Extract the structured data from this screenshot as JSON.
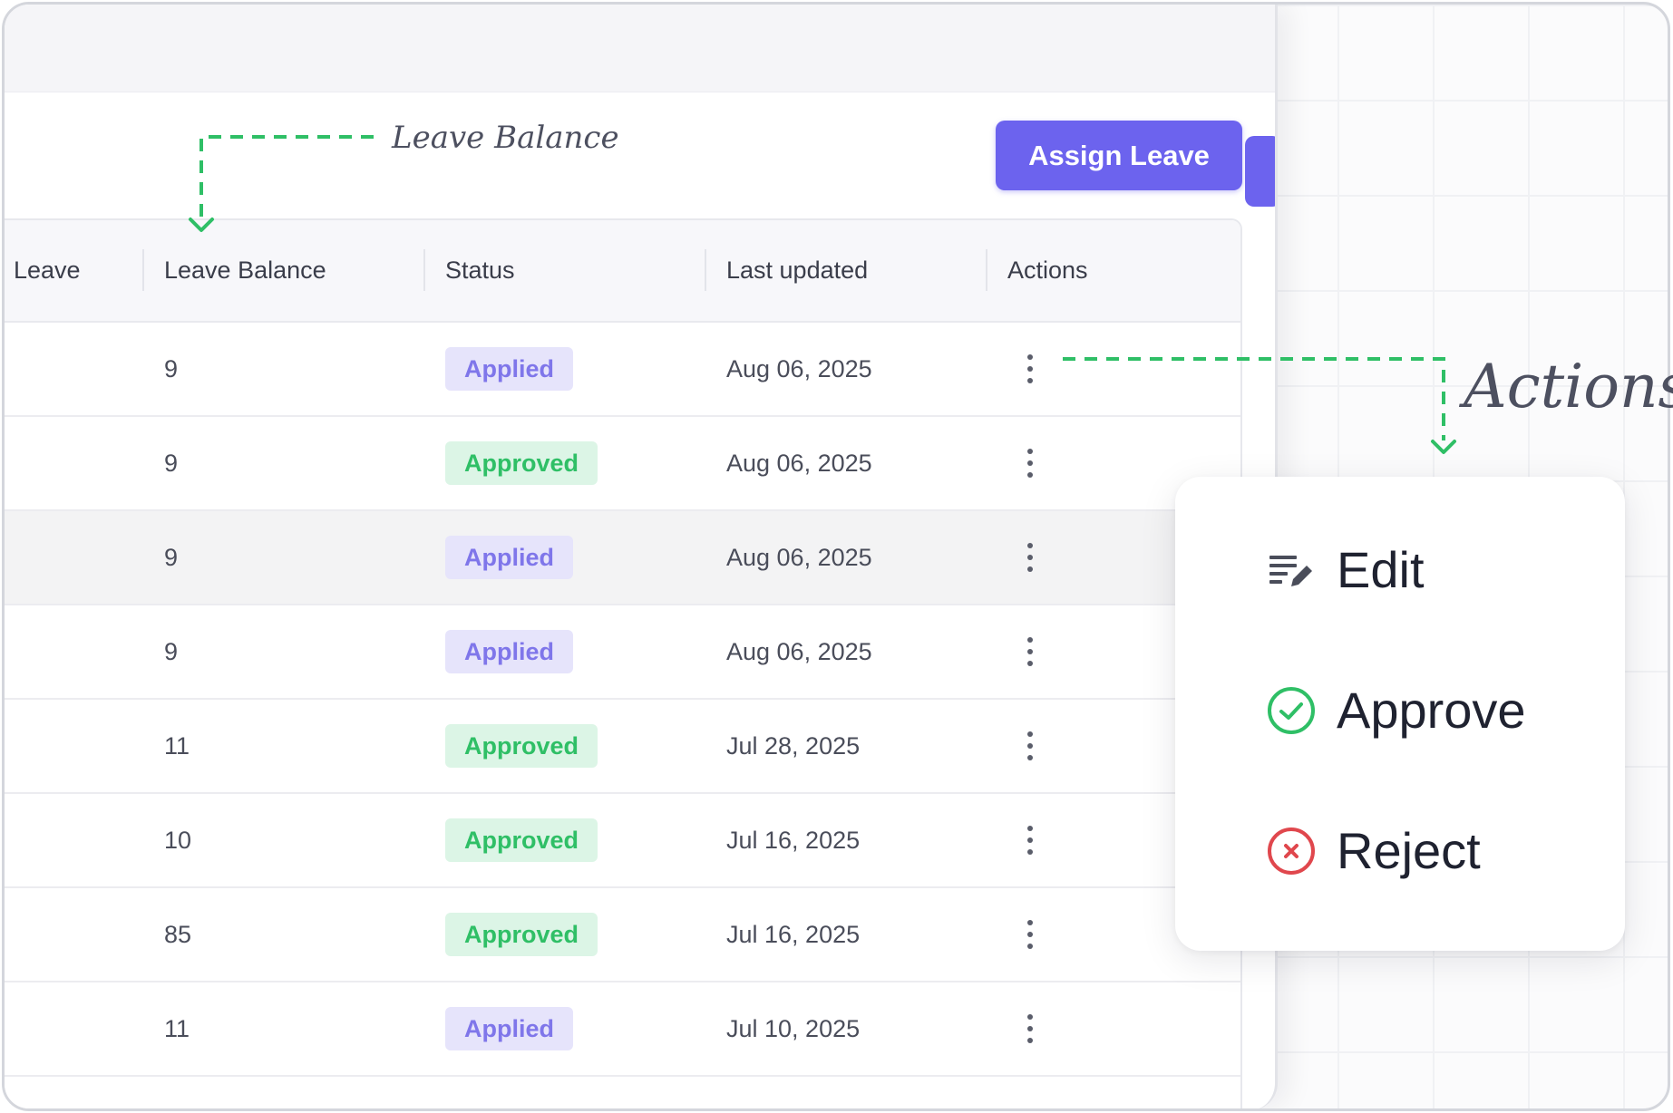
{
  "toolbar": {
    "assign_label": "Assign Leave"
  },
  "annotations": {
    "leave_balance": "Leave Balance",
    "actions": "Actions"
  },
  "table": {
    "headers": [
      "Leave",
      "Leave Balance",
      "Status",
      "Last updated",
      "Actions"
    ],
    "rows": [
      {
        "balance": "9",
        "status": "Applied",
        "updated": "Aug 06, 2025"
      },
      {
        "balance": "9",
        "status": "Approved",
        "updated": "Aug 06, 2025"
      },
      {
        "balance": "9",
        "status": "Applied",
        "updated": "Aug 06, 2025"
      },
      {
        "balance": "9",
        "status": "Applied",
        "updated": "Aug 06, 2025"
      },
      {
        "balance": "11",
        "status": "Approved",
        "updated": "Jul 28, 2025"
      },
      {
        "balance": "10",
        "status": "Approved",
        "updated": "Jul 16, 2025"
      },
      {
        "balance": "85",
        "status": "Approved",
        "updated": "Jul 16, 2025"
      },
      {
        "balance": "11",
        "status": "Applied",
        "updated": "Jul 10, 2025"
      }
    ]
  },
  "menu": {
    "items": [
      {
        "label": "Edit",
        "icon": "edit-list-icon"
      },
      {
        "label": "Approve",
        "icon": "check-circle-icon"
      },
      {
        "label": "Reject",
        "icon": "x-circle-icon"
      }
    ]
  },
  "colors": {
    "accent": "#6c63ee",
    "applied_bg": "#e6e4fb",
    "applied_text": "#7f76ea",
    "approved_bg": "#dcf5e6",
    "approved_text": "#2fbf66",
    "approve_icon": "#2fbf66",
    "reject_icon": "#e0474d",
    "annotation_line": "#2fbf66"
  }
}
